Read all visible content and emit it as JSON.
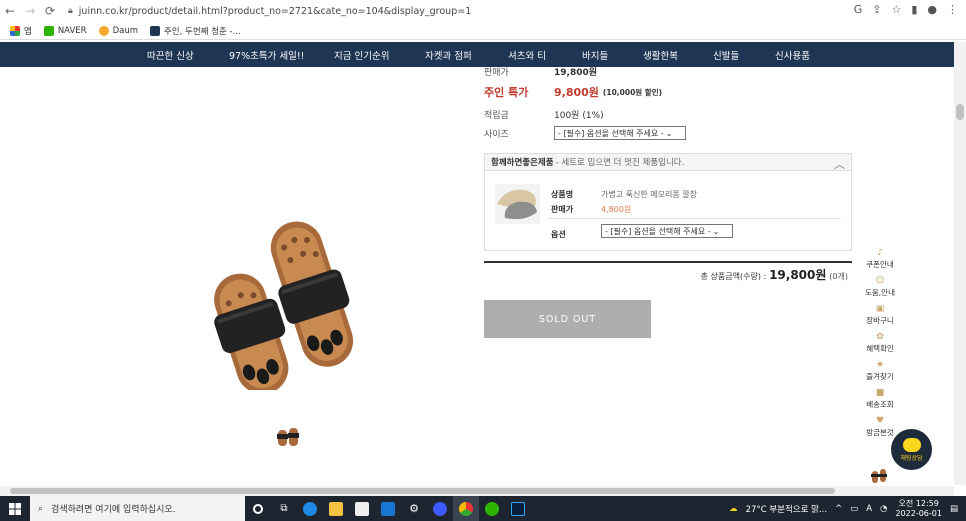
{
  "browser": {
    "url": "juinn.co.kr/product/detail.html?product_no=2721&cate_no=104&display_group=1",
    "bookmarks": [
      {
        "label": "앱"
      },
      {
        "label": "NAVER"
      },
      {
        "label": "Daum"
      },
      {
        "label": "주인, 두번째 청춘 -..."
      }
    ]
  },
  "nav": {
    "items": [
      "따끈한 신상",
      "97%초특가 세일!!",
      "지금 인기순위",
      "자켓과 점퍼",
      "셔츠와 티",
      "바지들",
      "생활한복",
      "신발들",
      "신사용품"
    ]
  },
  "product": {
    "sale_price_label": "판매가",
    "sale_price": "19,800원",
    "special_label": "주인 특가",
    "special_price": "9,800원",
    "special_note": "(10,000원 할인)",
    "points_label": "적립금",
    "points_value": "100원 (1%)",
    "size_label": "사이즈",
    "size_select": "- [필수] 옵션을 선택해 주세요 -"
  },
  "combo": {
    "title": "함께하면좋은제품",
    "subtitle": "- 세트로 입으면 더 멋진 제품입니다.",
    "name_label": "상품명",
    "name_value": "가볍고 푹신한 메모리폼 깔창",
    "price_label": "판매가",
    "price_value": "4,800원",
    "option_label": "옵션",
    "option_select": "- [필수] 옵션을 선택해 주세요 -"
  },
  "total": {
    "label": "총 상품금액(수량) :",
    "value": "19,800원",
    "count": "(0개)"
  },
  "soldout_label": "SOLD OUT",
  "side_menu": [
    {
      "label": "쿠폰안내",
      "icon": "bell-icon"
    },
    {
      "label": "도움,안내",
      "icon": "smile-icon"
    },
    {
      "label": "장바구니",
      "icon": "bag-icon"
    },
    {
      "label": "혜택확인",
      "icon": "gift-icon"
    },
    {
      "label": "즐겨찾기",
      "icon": "star-icon"
    },
    {
      "label": "배송조회",
      "icon": "truck-icon"
    },
    {
      "label": "방금본것",
      "icon": "heart-icon"
    }
  ],
  "chat_label": "채팅상담",
  "taskbar": {
    "search_placeholder": "검색하려면 여기에 입력하십시오.",
    "weather": "27°C 부분적으로 맑...",
    "time": "오전 12:59",
    "date": "2022-06-01"
  },
  "colors": {
    "nav_bg": "#1e3553",
    "price_red": "#c0392b",
    "soldout_bg": "#aeaeae"
  }
}
